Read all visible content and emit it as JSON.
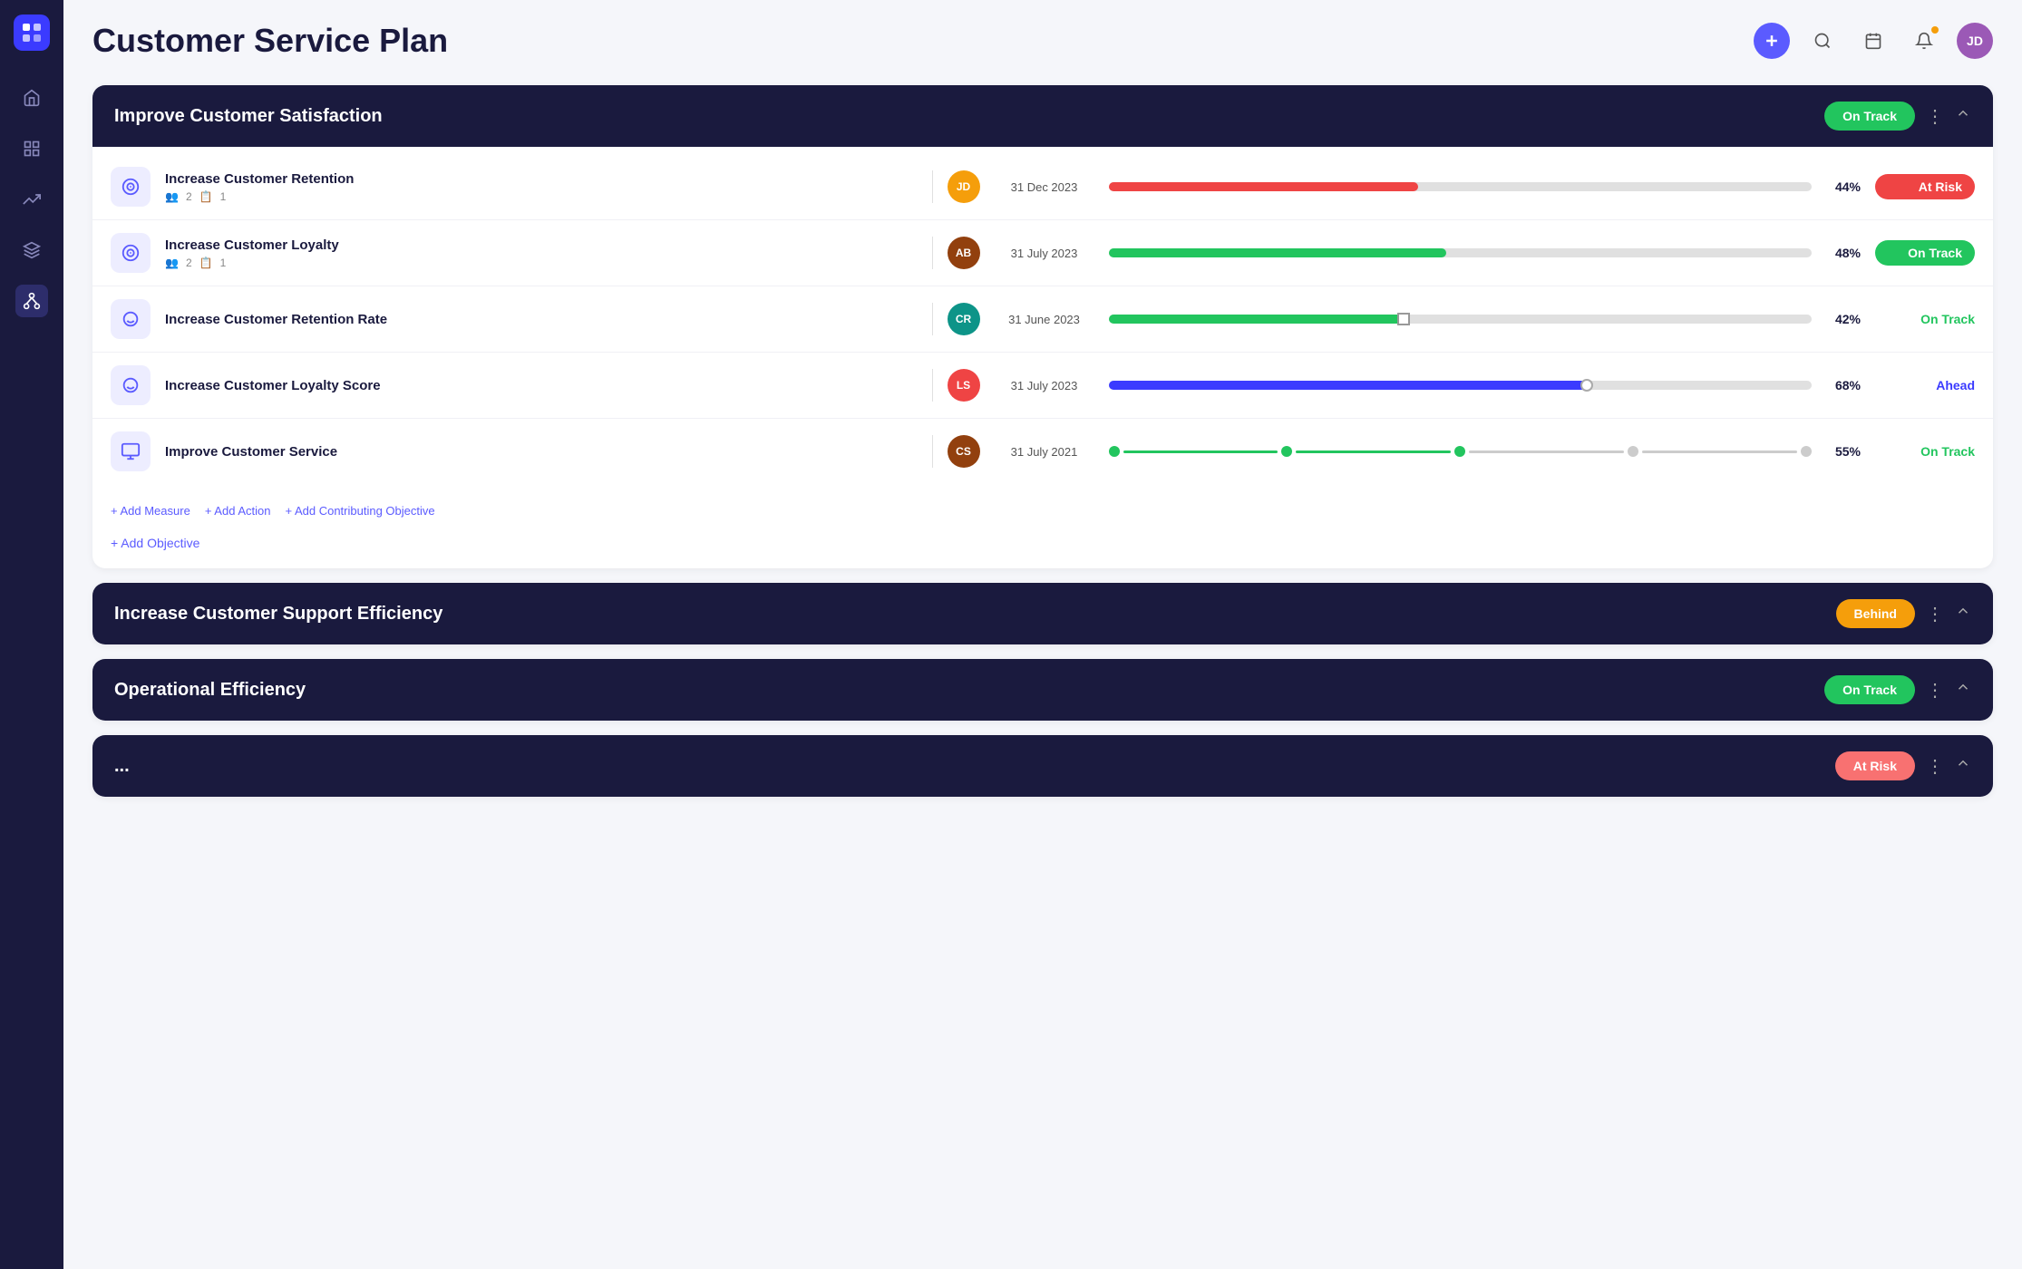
{
  "page": {
    "title": "Customer Service Plan"
  },
  "header": {
    "add_label": "+",
    "avatar_initials": "JD"
  },
  "sidebar": {
    "logo": "⊞",
    "items": [
      {
        "icon": "🏠",
        "label": "Home",
        "active": false
      },
      {
        "icon": "📊",
        "label": "Dashboard",
        "active": false
      },
      {
        "icon": "📈",
        "label": "Analytics",
        "active": false
      },
      {
        "icon": "🗂",
        "label": "Layers",
        "active": false
      },
      {
        "icon": "⚙",
        "label": "Network",
        "active": true
      }
    ]
  },
  "objectives": [
    {
      "id": "obj1",
      "title": "Improve Customer Satisfaction",
      "status": "On Track",
      "status_type": "green",
      "expanded": true,
      "key_results": [
        {
          "name": "Increase Customer Retention",
          "assignees": "2",
          "tasks": "1",
          "due_date": "31 Dec 2023",
          "progress": 44,
          "progress_color": "#ef4444",
          "status": "At Risk",
          "status_type": "badge-red",
          "avatar_color": "av-orange",
          "avatar_initials": "JD"
        },
        {
          "name": "Increase Customer Loyalty",
          "assignees": "2",
          "tasks": "1",
          "due_date": "31 July 2023",
          "progress": 48,
          "progress_color": "#22c55e",
          "status": "On Track",
          "status_type": "badge-green",
          "avatar_color": "av-brown",
          "avatar_initials": "AB"
        },
        {
          "name": "Increase Customer Retention Rate",
          "due_date": "31 June 2023",
          "progress": 42,
          "progress_color": "#22c55e",
          "status": "On Track",
          "status_type": "text-green",
          "avatar_color": "av-teal",
          "avatar_initials": "CR"
        },
        {
          "name": "Increase Customer Loyalty Score",
          "due_date": "31 July 2023",
          "progress": 68,
          "progress_color": "#3b3bff",
          "status": "Ahead",
          "status_type": "text-blue",
          "avatar_color": "av-blue",
          "avatar_initials": "LS"
        },
        {
          "name": "Improve Customer Service",
          "due_date": "31 July 2021",
          "progress": 55,
          "progress_color": "#22c55e",
          "status": "On Track",
          "status_type": "text-green",
          "avatar_color": "av-brown",
          "avatar_initials": "CS"
        }
      ],
      "add_links": {
        "measure": "+ Add Measure",
        "action": "+ Add Action",
        "contributing": "+ Add Contributing Objective"
      },
      "add_objective": "+ Add Objective"
    },
    {
      "id": "obj2",
      "title": "Increase Customer Support Efficiency",
      "status": "Behind",
      "status_type": "yellow",
      "expanded": false,
      "key_results": []
    },
    {
      "id": "obj3",
      "title": "Operational Efficiency",
      "status": "On Track",
      "status_type": "green",
      "expanded": false,
      "key_results": []
    },
    {
      "id": "obj4",
      "title": "...",
      "status": "At Risk",
      "status_type": "pink",
      "expanded": false,
      "key_results": []
    }
  ]
}
